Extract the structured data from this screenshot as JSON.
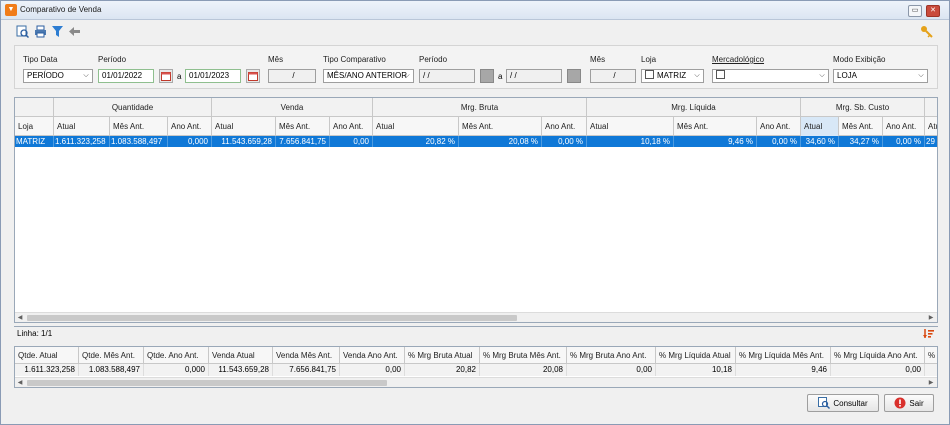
{
  "window": {
    "title": "Comparativo de Venda",
    "min_label": "▭",
    "close_label": "✕"
  },
  "toolbar": {
    "tools": [
      {
        "icon": "search-icon"
      },
      {
        "icon": "print-icon"
      },
      {
        "icon": "filter-icon"
      },
      {
        "icon": "back-arrow-icon"
      }
    ],
    "key_icon": "key-icon"
  },
  "filters": {
    "tipo_data": {
      "label": "Tipo Data",
      "value": "PERÍODO"
    },
    "periodo1": {
      "label": "Período",
      "start": "01/01/2022",
      "sep": "a",
      "end": "01/01/2023"
    },
    "mes1": {
      "label": "Mês",
      "value": "/"
    },
    "tipo_comparativo": {
      "label": "Tipo Comparativo",
      "value": "MÊS/ANO ANTERIOR"
    },
    "periodo2": {
      "label": "Período",
      "start": " / /",
      "sep": "a",
      "end": " / /"
    },
    "mes2": {
      "label": "Mês",
      "value": "/"
    },
    "loja": {
      "label": "Loja",
      "value": "MATRIZ"
    },
    "mercadologico": {
      "label": "Mercadológico",
      "value": ""
    },
    "modo_exibicao": {
      "label": "Modo Exibição",
      "value": "LOJA"
    }
  },
  "grid": {
    "groups": [
      "",
      "Quantidade",
      "Venda",
      "Mrg. Bruta",
      "Mrg. Líquida",
      "Mrg. Sb. Custo"
    ],
    "columns": [
      "Loja",
      "Atual",
      "Mês Ant.",
      "Ano Ant.",
      "Atual",
      "Mês Ant.",
      "Ano Ant.",
      "Atual",
      "Mês Ant.",
      "Ano Ant.",
      "Atual",
      "Mês Ant.",
      "Ano Ant.",
      "Atual",
      "Mês Ant.",
      "Ano Ant.",
      "Atu"
    ],
    "rows": [
      [
        "MATRIZ",
        "1.611.323,258",
        "1.083.588,497",
        "0,000",
        "11.543.659,28",
        "7.656.841,75",
        "0,00",
        "20,82 %",
        "20,08 %",
        "0,00 %",
        "10,18 %",
        "9,46 %",
        "0,00 %",
        "34,60 %",
        "34,27 %",
        "0,00 %",
        "29"
      ]
    ]
  },
  "status": {
    "text": "Linha: 1/1"
  },
  "totals": {
    "columns": [
      "Qtde. Atual",
      "Qtde. Mês Ant.",
      "Qtde. Ano Ant.",
      "Venda Atual",
      "Venda Mês Ant.",
      "Venda Ano Ant.",
      "% Mrg Bruta Atual",
      "% Mrg Bruta Mês Ant.",
      "% Mrg Bruta Ano Ant.",
      "% Mrg Líquida Atual",
      "% Mrg Líquida Mês Ant.",
      "% Mrg Líquida Ano Ant.",
      "%"
    ],
    "values": [
      "1.611.323,258",
      "1.083.588,497",
      "0,000",
      "11.543.659,28",
      "7.656.841,75",
      "0,00",
      "20,82",
      "20,08",
      "0,00",
      "10,18",
      "9,46",
      "0,00",
      ""
    ]
  },
  "buttons": {
    "consultar": "Consultar",
    "sair": "Sair"
  },
  "colors": {
    "selected_row": "#0f78d7",
    "accent": "#f07c1a"
  }
}
